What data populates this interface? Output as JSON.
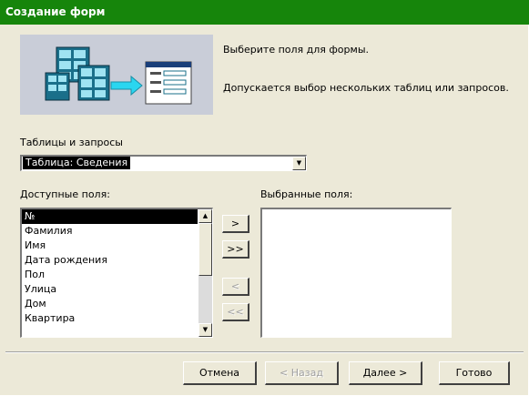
{
  "window": {
    "title": "Создание форм"
  },
  "info": {
    "line1": "Выберите поля для формы.",
    "line2": "Допускается выбор нескольких таблиц или запросов."
  },
  "tables": {
    "label": "Таблицы и запросы",
    "selected_value": "Таблица: Сведения"
  },
  "available": {
    "label": "Доступные поля:",
    "items": [
      "№",
      "Фамилия",
      "Имя",
      "Дата рождения",
      "Пол",
      "Улица",
      "Дом",
      "Квартира"
    ],
    "selected_index": 0
  },
  "selected_fields": {
    "label": "Выбранные поля:",
    "items": []
  },
  "move_buttons": {
    "add_one": ">",
    "add_all": ">>",
    "remove_one": "<",
    "remove_all": "<<"
  },
  "buttons": {
    "cancel": "Отмена",
    "back": "< Назад",
    "next": "Далее >",
    "finish": "Готово"
  },
  "colors": {
    "titlebar": "#16850b",
    "dialog_bg": "#ece9d8",
    "selection": "#000000"
  }
}
